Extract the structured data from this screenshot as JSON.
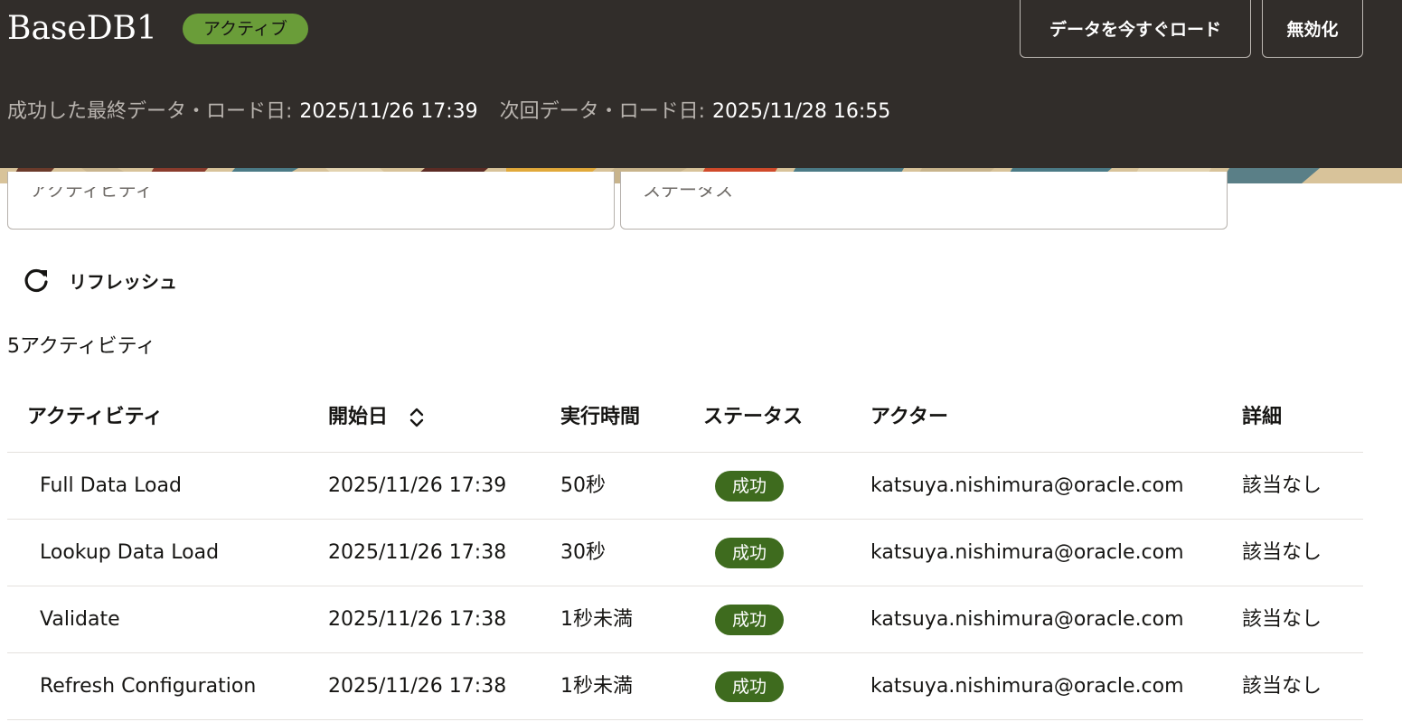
{
  "header": {
    "title": "BaseDB1",
    "status": "アクティブ",
    "load_now_button": "データを今すぐロード",
    "disable_button": "無効化",
    "last_load_label": "成功した最終データ・ロード日:",
    "last_load_value": "2025/11/26 17:39",
    "next_load_label": "次回データ・ロード日:",
    "next_load_value": "2025/11/28 16:55"
  },
  "filters": {
    "activity_label": "アクティビティ",
    "status_label": "ステータス"
  },
  "toolbar": {
    "refresh_label": "リフレッシュ",
    "count_text": "5アクティビティ"
  },
  "table": {
    "columns": [
      "アクティビティ",
      "開始日",
      "実行時間",
      "ステータス",
      "アクター",
      "詳細"
    ],
    "rows": [
      {
        "activity": "Full Data Load",
        "start": "2025/11/26 17:39",
        "duration": "50秒",
        "status": "成功",
        "actor": "katsuya.nishimura@oracle.com",
        "details": "該当なし"
      },
      {
        "activity": "Lookup Data Load",
        "start": "2025/11/26 17:38",
        "duration": "30秒",
        "status": "成功",
        "actor": "katsuya.nishimura@oracle.com",
        "details": "該当なし"
      },
      {
        "activity": "Validate",
        "start": "2025/11/26 17:38",
        "duration": "1秒未満",
        "status": "成功",
        "actor": "katsuya.nishimura@oracle.com",
        "details": "該当なし"
      },
      {
        "activity": "Refresh Configuration",
        "start": "2025/11/26 17:38",
        "duration": "1秒未満",
        "status": "成功",
        "actor": "katsuya.nishimura@oracle.com",
        "details": "該当なし"
      }
    ]
  },
  "colors": {
    "header_bg": "#312d2a",
    "active_badge": "#6a9d39",
    "success_badge": "#3e6b1e"
  },
  "icons": {
    "refresh": "refresh-icon",
    "sort": "sort-icon"
  }
}
